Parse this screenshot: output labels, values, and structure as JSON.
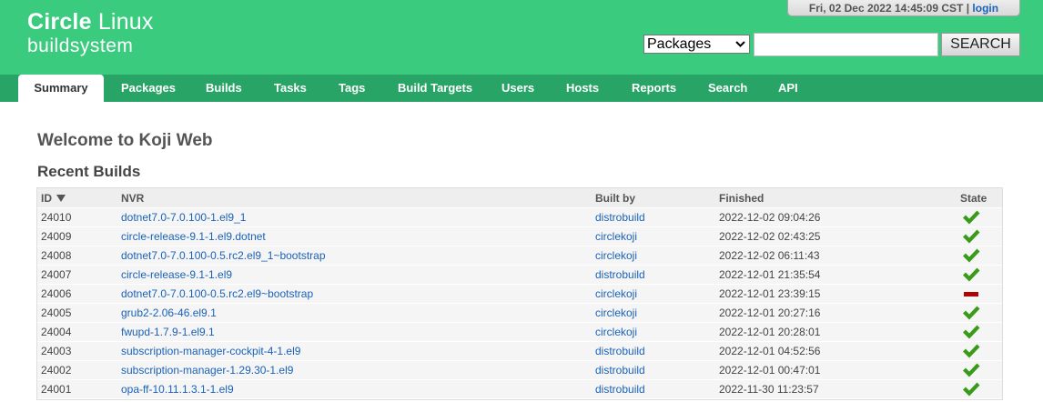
{
  "header": {
    "logo_line1_bold": "Circle",
    "logo_line1_light": " Linux",
    "logo_line2": "buildsystem",
    "datetime": "Fri, 02 Dec 2022 14:45:09 CST",
    "separator": "|",
    "login_label": "login",
    "search_select_value": "Packages",
    "search_input_value": "",
    "search_button_label": "SEARCH"
  },
  "colors": {
    "header_bg": "#3bcb7f",
    "nav_bg": "#28a566",
    "link": "#1a62b8",
    "state_complete": "#3a9a1a",
    "state_failed": "#b30000"
  },
  "nav": {
    "tabs": [
      {
        "label": "Summary",
        "active": true
      },
      {
        "label": "Packages"
      },
      {
        "label": "Builds"
      },
      {
        "label": "Tasks"
      },
      {
        "label": "Tags"
      },
      {
        "label": "Build Targets"
      },
      {
        "label": "Users"
      },
      {
        "label": "Hosts"
      },
      {
        "label": "Reports"
      },
      {
        "label": "Search"
      },
      {
        "label": "API"
      }
    ]
  },
  "main": {
    "title": "Welcome to Koji Web",
    "section_title": "Recent Builds",
    "columns": [
      "ID",
      "NVR",
      "Built by",
      "Finished",
      "State"
    ],
    "sort_icon": "sort-descending-icon",
    "rows": [
      {
        "id": "24010",
        "nvr": "dotnet7.0-7.0.100-1.el9_1",
        "owner": "distrobuild",
        "finished": "2022-12-02 09:04:26",
        "state": "complete"
      },
      {
        "id": "24009",
        "nvr": "circle-release-9.1-1.el9.dotnet",
        "owner": "circlekoji",
        "finished": "2022-12-02 02:43:25",
        "state": "complete"
      },
      {
        "id": "24008",
        "nvr": "dotnet7.0-7.0.100-0.5.rc2.el9_1~bootstrap",
        "owner": "circlekoji",
        "finished": "2022-12-02 06:11:43",
        "state": "complete"
      },
      {
        "id": "24007",
        "nvr": "circle-release-9.1-1.el9",
        "owner": "distrobuild",
        "finished": "2022-12-01 21:35:54",
        "state": "complete"
      },
      {
        "id": "24006",
        "nvr": "dotnet7.0-7.0.100-0.5.rc2.el9~bootstrap",
        "owner": "circlekoji",
        "finished": "2022-12-01 23:39:15",
        "state": "failed"
      },
      {
        "id": "24005",
        "nvr": "grub2-2.06-46.el9.1",
        "owner": "circlekoji",
        "finished": "2022-12-01 20:27:16",
        "state": "complete"
      },
      {
        "id": "24004",
        "nvr": "fwupd-1.7.9-1.el9.1",
        "owner": "circlekoji",
        "finished": "2022-12-01 20:28:01",
        "state": "complete"
      },
      {
        "id": "24003",
        "nvr": "subscription-manager-cockpit-4-1.el9",
        "owner": "distrobuild",
        "finished": "2022-12-01 04:52:56",
        "state": "complete"
      },
      {
        "id": "24002",
        "nvr": "subscription-manager-1.29.30-1.el9",
        "owner": "distrobuild",
        "finished": "2022-12-01 00:47:01",
        "state": "complete"
      },
      {
        "id": "24001",
        "nvr": "opa-ff-10.11.1.3.1-1.el9",
        "owner": "distrobuild",
        "finished": "2022-11-30 11:23:57",
        "state": "complete"
      }
    ]
  }
}
